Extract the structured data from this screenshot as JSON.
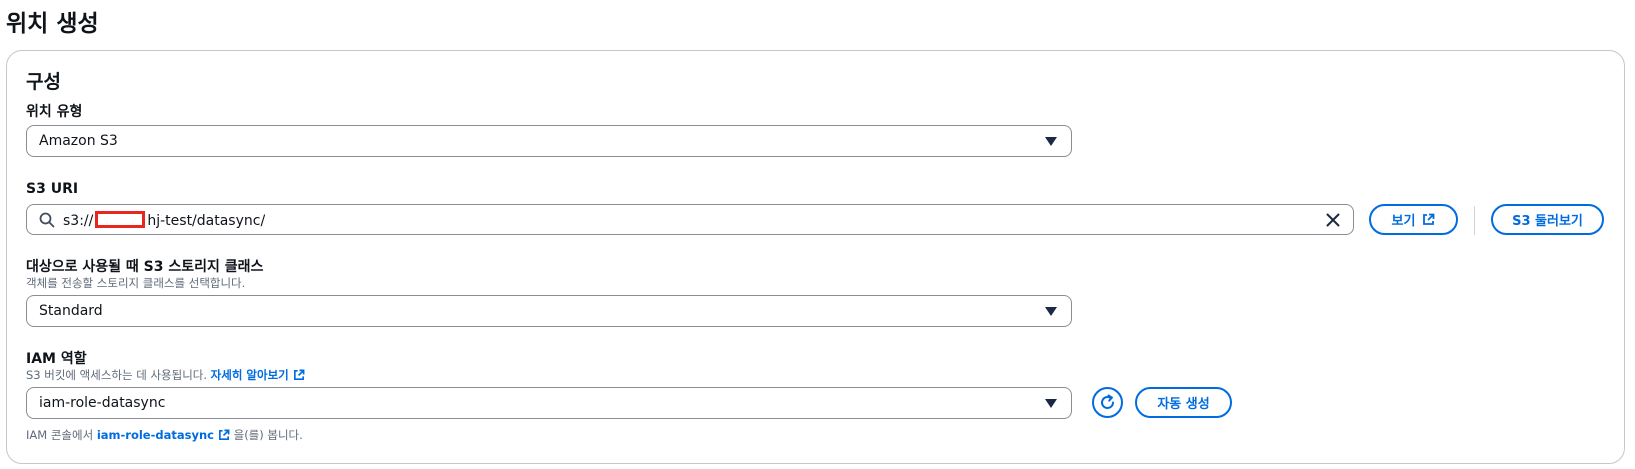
{
  "page": {
    "title": "위치 생성"
  },
  "config": {
    "section_title": "구성",
    "location_type": {
      "label": "위치 유형",
      "value": "Amazon S3"
    },
    "s3_uri": {
      "label": "S3 URI",
      "value_prefix": "s3://",
      "value_suffix": "hj-test/datasync/",
      "view_label": "보기",
      "browse_label": "S3 둘러보기"
    },
    "storage_class": {
      "label": "대상으로 사용될 때 S3 스토리지 클래스",
      "description": "객체를 전송할 스토리지 클래스를 선택합니다.",
      "value": "Standard"
    },
    "iam_role": {
      "label": "IAM 역할",
      "description": "S3 버킷에 액세스하는 데 사용됩니다.",
      "learn_more": "자세히 알아보기",
      "value": "iam-role-datasync",
      "auto_create_label": "자동 생성",
      "footer_prefix": "IAM 콘솔에서",
      "footer_link": "iam-role-datasync",
      "footer_suffix": "을(를) 봅니다."
    }
  },
  "icons": {
    "search": "search-icon",
    "clear": "close-icon",
    "external": "external-link-icon",
    "caret": "caret-down-icon",
    "refresh": "refresh-icon"
  },
  "colors": {
    "accent": "#006ce0",
    "redaction": "#e8261d"
  }
}
